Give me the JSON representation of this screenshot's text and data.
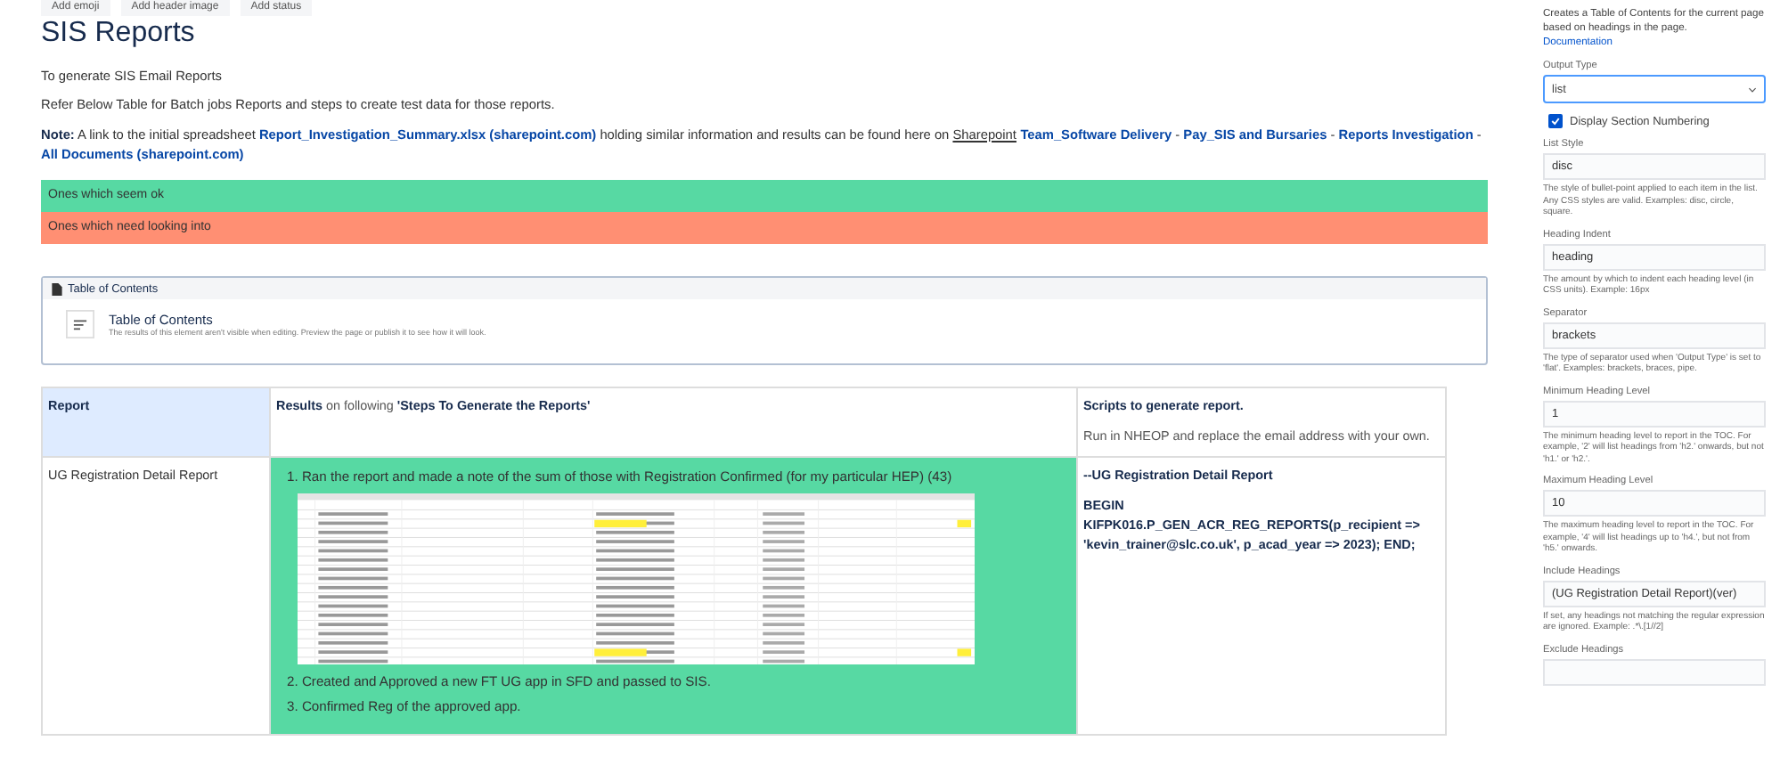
{
  "toolbar": [
    "Add emoji",
    "Add header image",
    "Add status"
  ],
  "title": "SIS Reports",
  "intro": [
    "To generate SIS Email Reports",
    "Refer Below Table for Batch jobs Reports and steps to create test data for those reports."
  ],
  "note": [
    {
      "kind": "bold",
      "text": "Note:"
    },
    {
      "kind": "text",
      "text": " A link to the initial spreadsheet "
    },
    {
      "kind": "link",
      "text": "Report_Investigation_Summary.xlsx (sharepoint.com)"
    },
    {
      "kind": "text",
      "text": " holding similar information and results can be found here on "
    },
    {
      "kind": "underline",
      "text": "Sharepoint"
    },
    {
      "kind": "link",
      "text": "Team_Software Delivery"
    },
    {
      "kind": "text",
      "text": " - "
    },
    {
      "kind": "link",
      "text": "Pay_SIS and Bursaries"
    },
    {
      "kind": "text",
      "text": " - "
    },
    {
      "kind": "link",
      "text": "Reports Investigation"
    },
    {
      "kind": "text",
      "text": " - "
    },
    {
      "kind": "link",
      "text": "All Documents (sharepoint.com)"
    }
  ],
  "legend": [
    {
      "label": "Ones which seem ok",
      "color": "#57d9a3"
    },
    {
      "label": "Ones which need looking into",
      "color": "#ff8f73"
    }
  ],
  "toc": {
    "header": "Table of Contents",
    "title": "Table of Contents",
    "description": "The results of this element aren't visible when editing. Preview the page or publish it to see how it will look."
  },
  "table": {
    "headers": [
      {
        "kind": "plain",
        "text": "Report"
      },
      {
        "kind": "results",
        "bold": "Results",
        "text": " on following ",
        "quoted": "'Steps To Generate the Reports'"
      },
      {
        "kind": "scripts",
        "text": "Scripts to generate report.",
        "sub": "Run in NHEOP and replace the email address with your own."
      }
    ],
    "rows": [
      {
        "report": "UG Registration Detail Report",
        "color": "#57d9a3",
        "steps": [
          {
            "kind": "step",
            "number": "1.",
            "text": "Ran the report and made a note of the sum of those with Registration Confirmed (for my particular HEP) (43)"
          },
          {
            "kind": "spreadsheet"
          },
          {
            "kind": "step",
            "number": "2.",
            "text": "Created and Approved a new FT UG app in SFD  and passed to SIS."
          },
          {
            "kind": "step",
            "number": "3.",
            "text": "Confirmed Reg of the approved app."
          }
        ],
        "script_title": "--UG Registration Detail Report",
        "script": "BEGIN KIFPK016.P_GEN_ACR_REG_REPORTS(p_recipient => 'kevin_trainer@slc.co.uk', p_acad_year => 2023); END;"
      }
    ]
  },
  "panel": {
    "description": "Creates a Table of Contents for the current page based on headings in the page.",
    "link": "Documentation",
    "fields": [
      {
        "kind": "select",
        "label": "Output Type",
        "value": "list"
      },
      {
        "kind": "checkbox",
        "label": "Display Section Numbering",
        "checked": true
      },
      {
        "kind": "text",
        "label": "List Style",
        "value": "disc",
        "help": "The style of bullet-point applied to each item in the list. Any CSS styles are valid. Examples: disc, circle, square."
      },
      {
        "kind": "text",
        "label": "Heading Indent",
        "value": "heading",
        "help": "The amount by which to indent each heading level (in CSS units). Example: 16px"
      },
      {
        "kind": "text",
        "label": "Separator",
        "value": "brackets",
        "help": "The type of separator used when 'Output Type' is set to 'flat'. Examples: brackets, braces, pipe."
      },
      {
        "kind": "text",
        "label": "Minimum Heading Level",
        "value": "1",
        "help": "The minimum heading level to report in the TOC. For example, '2' will list headings from 'h2.' onwards, but not 'h1.' or 'h2.'."
      },
      {
        "kind": "text",
        "label": "Maximum Heading Level",
        "value": "10",
        "help": "The maximum heading level to report in the TOC. For example, '4' will list headings up to 'h4.', but not from 'h5.' onwards."
      },
      {
        "kind": "text",
        "label": "Include Headings",
        "value": "(UG Registration Detail Report)(ver)",
        "help": "If set, any headings not matching the regular expression are ignored. Example: .*\\.[1//2]"
      },
      {
        "kind": "text",
        "label": "Exclude Headings"
      }
    ]
  }
}
